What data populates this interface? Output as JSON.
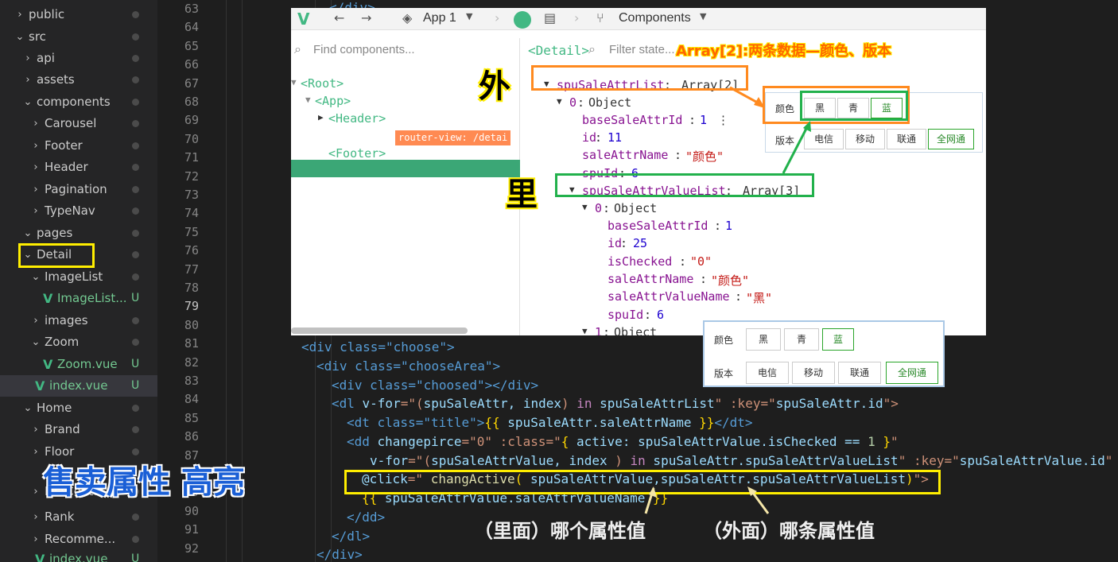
{
  "explorer": {
    "items": [
      {
        "label": "public",
        "type": "folder",
        "open": false
      },
      {
        "label": "src",
        "type": "folder",
        "open": true
      },
      {
        "label": "api",
        "type": "folder",
        "open": false
      },
      {
        "label": "assets",
        "type": "folder",
        "open": false
      },
      {
        "label": "components",
        "type": "folder",
        "open": true
      },
      {
        "label": "Carousel",
        "type": "folder",
        "open": false
      },
      {
        "label": "Footer",
        "type": "folder",
        "open": false
      },
      {
        "label": "Header",
        "type": "folder",
        "open": false
      },
      {
        "label": "Pagination",
        "type": "folder",
        "open": false
      },
      {
        "label": "TypeNav",
        "type": "folder",
        "open": false
      },
      {
        "label": "pages",
        "type": "folder",
        "open": true
      },
      {
        "label": "Detail",
        "type": "folder",
        "open": true
      },
      {
        "label": "ImageList",
        "type": "folder",
        "open": true
      },
      {
        "label": "ImageList...",
        "type": "vue",
        "status": "U"
      },
      {
        "label": "images",
        "type": "folder",
        "open": false
      },
      {
        "label": "Zoom",
        "type": "folder",
        "open": true
      },
      {
        "label": "Zoom.vue",
        "type": "vue",
        "status": "U"
      },
      {
        "label": "index.vue",
        "type": "vue",
        "status": "U"
      },
      {
        "label": "Home",
        "type": "folder",
        "open": true
      },
      {
        "label": "Brand",
        "type": "folder",
        "open": false
      },
      {
        "label": "Floor",
        "type": "folder",
        "open": false
      },
      {
        "label": "ListContai...",
        "type": "folder",
        "open": false
      },
      {
        "label": "Rank",
        "type": "folder",
        "open": false
      },
      {
        "label": "Recomme...",
        "type": "folder",
        "open": false
      },
      {
        "label": "index.vue",
        "type": "vue",
        "status": "U"
      }
    ]
  },
  "gutter": {
    "lines": [
      "63",
      "64",
      "65",
      "66",
      "67",
      "68",
      "69",
      "70",
      "71",
      "72",
      "73",
      "74",
      "75",
      "76",
      "77",
      "78",
      "79",
      "80",
      "81",
      "82",
      "83",
      "84",
      "85",
      "86",
      "87",
      "88",
      "89",
      "90",
      "91",
      "92"
    ],
    "active_line": "79"
  },
  "code": {
    "l81": "<div class=\"choose\">",
    "l82": "<div class=\"chooseArea\">",
    "l83": "<div class=\"choosed\"></div>",
    "l84_a": "<dl ",
    "l84_b": "v-for",
    "l84_c": "=\"(",
    "l84_d": "spuSaleAttr, index",
    "l84_e": ") ",
    "l84_f": "in",
    "l84_g": " spuSaleAttrList",
    "l84_h": "\" :key=\"",
    "l84_i": "spuSaleAttr.id",
    "l84_j": "\">",
    "l85_a": "<dt class=\"title\">",
    "l85_b": "{{",
    "l85_c": " spuSaleAttr.saleAttrName ",
    "l85_d": "}}",
    "l85_e": "</dt>",
    "l86_a": "<dd ",
    "l86_b": "changepirce",
    "l86_c": "=\"0\" :class=\"",
    "l86_d": "{",
    "l86_e": " active",
    "l86_f": ": spuSaleAttrValue.isChecked == ",
    "l86_g": "1",
    "l86_h": " }",
    "l86_i": "\"",
    "l87_a": "v-for",
    "l87_b": "=\"(",
    "l87_c": "spuSaleAttrValue, index ",
    "l87_d": ") ",
    "l87_e": "in",
    "l87_f": " spuSaleAttr.spuSaleAttrValueList",
    "l87_g": "\" :key=\"",
    "l87_h": "spuSaleAttrValue.id",
    "l87_i": "\"",
    "l88_a": "@click",
    "l88_b": "=\" ",
    "l88_c": "changActive",
    "l88_d": "(",
    "l88_e": " spuSaleAttrValue,spuSaleAttr.spuSaleAttrValueList",
    "l88_f": ")",
    "l88_g": "\">",
    "l89_a": "{{",
    "l89_b": " spuSaleAttrValue.saleAttrValueName ",
    "l89_c": "}}",
    "l90": "</dd>",
    "l91": "</dl>",
    "l92": "</div>",
    "l63": "</div>"
  },
  "devtools": {
    "app_label": "App 1",
    "components_label": "Components",
    "find_placeholder": "Find components...",
    "detail_tag": "<Detail>",
    "filter_placeholder": "Filter state...",
    "tree": {
      "root": "<Root>",
      "app": "<App>",
      "header": "<Header>",
      "detail": "<Detail>",
      "router_badge": "router-view: /detai",
      "footer": "<Footer>"
    },
    "state": {
      "list_key": "spuSaleAttrList",
      "list_val": "Array[2]",
      "obj0_key": "0",
      "obj_label": "Object",
      "baseSaleAttrId_key": "baseSaleAttrId",
      "baseSaleAttrId_val": "1",
      "id_key": "id",
      "id_val": "11",
      "saleAttrName_key": "saleAttrName",
      "saleAttrName_val": "\"颜色\"",
      "spuId_key": "spuId",
      "spuId_val": "6",
      "valuelist_key": "spuSaleAttrValueList",
      "valuelist_val": "Array[3]",
      "inner0_key": "0",
      "inner_baseSaleAttrId_val": "1",
      "inner_id_val": "25",
      "isChecked_key": "isChecked",
      "isChecked_val": "\"0\"",
      "inner_saleAttrName_val": "\"颜色\"",
      "saleAttrValueName_key": "saleAttrValueName",
      "saleAttrValueName_val": "\"黑\"",
      "inner_spuId_val": "6",
      "obj1_key": "1"
    }
  },
  "spec_panel_small": {
    "color_label": "颜色",
    "colors": [
      "黑",
      "青",
      "蓝"
    ],
    "version_label": "版本",
    "versions": [
      "电信",
      "移动",
      "联通",
      "全网通"
    ]
  },
  "spec_panel_large": {
    "color_label": "颜色",
    "colors": [
      "黑",
      "青",
      "蓝"
    ],
    "version_label": "版本",
    "versions": [
      "电信",
      "移动",
      "联通",
      "全网通"
    ]
  },
  "annotations": {
    "array_note": "Array[2]:两条数据—颜色、版本",
    "outer": "外",
    "inner": "里",
    "title": "售卖属性 高亮",
    "inner_caption": "（里面）哪个属性值",
    "outer_caption": "（外面）哪条属性值"
  },
  "colors": {
    "orange": "#ff8a1f",
    "green": "#22b14c",
    "yellow": "#ffee00",
    "vue_green": "#42b883"
  }
}
